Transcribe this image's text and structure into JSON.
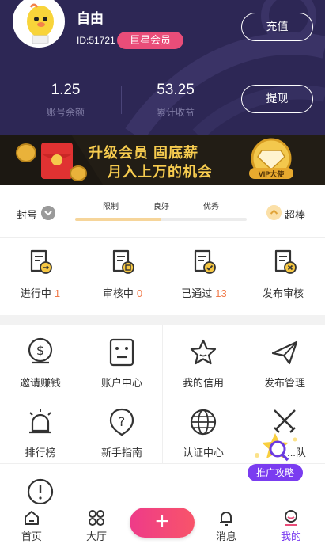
{
  "header": {
    "username": "自由",
    "user_id": "ID:51721",
    "vip_badge": "巨星会员",
    "recharge_label": "充值",
    "withdraw_label": "提现",
    "balance_value": "1.25",
    "balance_label": "账号余额",
    "earnings_value": "53.25",
    "earnings_label": "累计收益",
    "colors": {
      "background": "#2d2755",
      "badge": "#e94d79"
    }
  },
  "banner": {
    "line1": "升级会员 固底薪",
    "line2": "月入上万的机会",
    "vip_label": "VIP大使",
    "icons": [
      "coin-icon",
      "red-envelope-icon",
      "diamond-badge-icon"
    ]
  },
  "credit": {
    "left_label": "封号",
    "levels": [
      "限制",
      "良好",
      "优秀"
    ],
    "right_label": "超棒",
    "progress_fraction": 0.5,
    "colors": {
      "fill": "#f6d59a",
      "track": "#ececec"
    }
  },
  "tasks": [
    {
      "label": "进行中",
      "count": "1",
      "icon": "document-arrow-icon"
    },
    {
      "label": "审核中",
      "count": "0",
      "icon": "document-pending-icon"
    },
    {
      "label": "已通过",
      "count": "13",
      "icon": "document-check-icon"
    },
    {
      "label": "发布审核",
      "count": "",
      "icon": "document-reject-icon"
    }
  ],
  "tools": [
    {
      "label": "邀请赚钱",
      "icon": "coin-dollar-icon"
    },
    {
      "label": "账户中心",
      "icon": "account-face-icon"
    },
    {
      "label": "我的信用",
      "icon": "star-icon"
    },
    {
      "label": "发布管理",
      "icon": "paper-plane-icon"
    },
    {
      "label": "排行榜",
      "icon": "siren-icon"
    },
    {
      "label": "新手指南",
      "icon": "question-shield-icon"
    },
    {
      "label": "认证中心",
      "icon": "globe-icon"
    },
    {
      "label": "...队",
      "icon": "crossed-swords-icon"
    },
    {
      "label": "",
      "icon": "alert-icon"
    }
  ],
  "promo": {
    "label": "推广攻略",
    "icon": "magnifier-star-icon",
    "color": "#7a3cf0"
  },
  "nav": {
    "home": "首页",
    "hall": "大厅",
    "publish": "+",
    "messages": "消息",
    "mine": "我的",
    "active_color": "#7a3cf0",
    "fab_colors": [
      "#ee3b89",
      "#f8546a"
    ]
  }
}
